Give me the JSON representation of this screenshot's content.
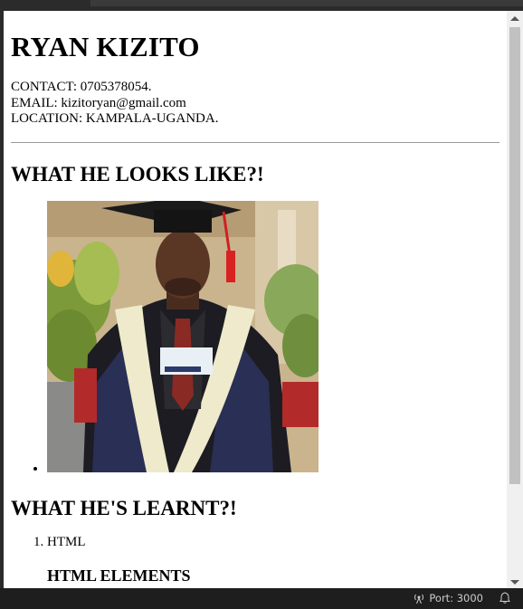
{
  "page": {
    "name": "RYAN KIZITO",
    "contact": "CONTACT: 0705378054.",
    "email": "EMAIL: kizitoryan@gmail.com",
    "location": "LOCATION: KAMPALA-UGANDA.",
    "looks_heading": "WHAT HE LOOKS LIKE?!",
    "photo_icon": "graduation-photo",
    "learnt_heading": "WHAT HE'S LEARNT?!",
    "skills": [
      "HTML"
    ],
    "sub_heading": "HTML ELEMENTS"
  },
  "statusbar": {
    "port_label": "Port: 3000",
    "port_icon": "broadcast-icon",
    "bell_icon": "bell-icon"
  }
}
